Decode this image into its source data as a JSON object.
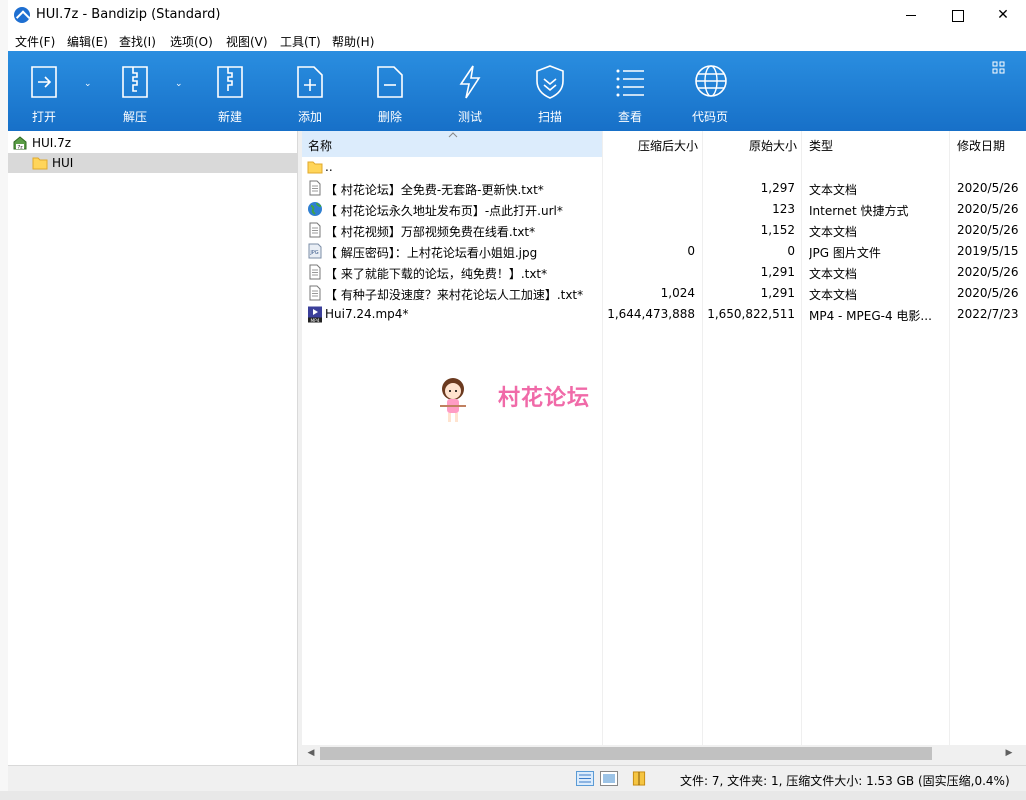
{
  "window": {
    "title": "HUI.7z - Bandizip (Standard)"
  },
  "menu": [
    {
      "label": "文件(F)"
    },
    {
      "label": "编辑(E)"
    },
    {
      "label": "查找(I)"
    },
    {
      "label": "选项(O)"
    },
    {
      "label": "视图(V)"
    },
    {
      "label": "工具(T)"
    },
    {
      "label": "帮助(H)"
    }
  ],
  "toolbar": {
    "open": "打开",
    "extract": "解压",
    "new": "新建",
    "add": "添加",
    "delete": "删除",
    "test": "测试",
    "scan": "扫描",
    "view": "查看",
    "codepage": "代码页"
  },
  "tree": {
    "archive": "HUI.7z",
    "folder": "HUI"
  },
  "columns": {
    "name": "名称",
    "compressed": "压缩后大小",
    "original": "原始大小",
    "type": "类型",
    "modified": "修改日期"
  },
  "files": [
    {
      "name": "..",
      "compressed": "",
      "original": "",
      "type": "",
      "modified": "",
      "icon": "folder-icon"
    },
    {
      "name": "【 村花论坛】全免费-无套路-更新快.txt*",
      "compressed": "",
      "original": "1,297",
      "type": "文本文档",
      "modified": "2020/5/26",
      "icon": "text-file-icon"
    },
    {
      "name": "【 村花论坛永久地址发布页】-点此打开.url*",
      "compressed": "",
      "original": "123",
      "type": "Internet 快捷方式",
      "modified": "2020/5/26",
      "icon": "globe-icon"
    },
    {
      "name": "【 村花视频】万部视频免费在线看.txt*",
      "compressed": "",
      "original": "1,152",
      "type": "文本文档",
      "modified": "2020/5/26",
      "icon": "text-file-icon"
    },
    {
      "name": "【 解压密码】：上村花论坛看小姐姐.jpg",
      "compressed": "0",
      "original": "0",
      "type": "JPG 图片文件",
      "modified": "2019/5/15",
      "icon": "jpg-file-icon"
    },
    {
      "name": "【 来了就能下载的论坛，纯免费！】.txt*",
      "compressed": "",
      "original": "1,291",
      "type": "文本文档",
      "modified": "2020/5/26",
      "icon": "text-file-icon"
    },
    {
      "name": "【 有种子却没速度？来村花论坛人工加速】.txt*",
      "compressed": "1,024",
      "original": "1,291",
      "type": "文本文档",
      "modified": "2020/5/26",
      "icon": "text-file-icon"
    },
    {
      "name": "Hui7.24.mp4*",
      "compressed": "1,644,473,888",
      "original": "1,650,822,511",
      "type": "MP4 - MPEG-4 电影...",
      "modified": "2022/7/23",
      "icon": "mp4-file-icon"
    }
  ],
  "watermark": "村花论坛",
  "status": "文件: 7, 文件夹: 1, 压缩文件大小: 1.53 GB (固实压缩,0.4%)",
  "colors": {
    "toolbar": "#1f7fd6",
    "selection": "#d9d9d9",
    "sort_header": "#dcecfc",
    "watermark": "#f06aa8"
  }
}
